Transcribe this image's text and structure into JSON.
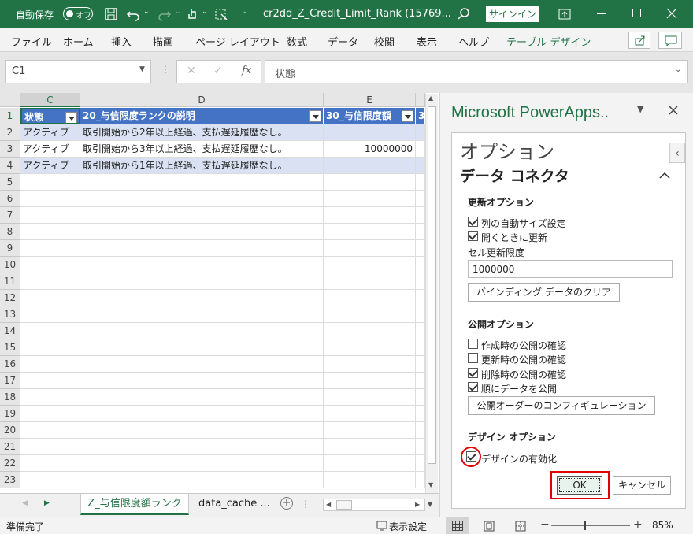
{
  "titlebar": {
    "autosave_label": "自動保存",
    "autosave_state": "オフ",
    "filename": "cr2dd_Z_Credit_Limit_Rank (15769...",
    "signin_label": "サインイン"
  },
  "ribbon": {
    "tabs": [
      "ファイル",
      "ホーム",
      "挿入",
      "描画",
      "ページ レイアウト",
      "数式",
      "データ",
      "校閲",
      "表示",
      "ヘルプ",
      "テーブル デザイン"
    ],
    "active_tab_color": "#217346"
  },
  "formula_bar": {
    "name_box": "C1",
    "fx_label": "fx",
    "content": "状態"
  },
  "sheet": {
    "columns": [
      "C",
      "D",
      "E"
    ],
    "header": [
      "状態",
      "20_与信限度ランクの説明",
      "30_与信限度額",
      "3"
    ],
    "rows": [
      {
        "n": "2",
        "c": "アクティブ",
        "d": "取引開始から2年以上経過、支払遅延履歴なし。",
        "e": ""
      },
      {
        "n": "3",
        "c": "アクティブ",
        "d": "取引開始から3年以上経過、支払遅延履歴なし。",
        "e": "10000000"
      },
      {
        "n": "4",
        "c": "アクティブ",
        "d": "取引開始から1年以上経過、支払遅延履歴なし。",
        "e": ""
      }
    ],
    "header_row_num": "1",
    "empty_rows": [
      "5",
      "6",
      "7",
      "8",
      "9",
      "10",
      "11",
      "12",
      "13",
      "14",
      "15",
      "16",
      "17",
      "18",
      "19",
      "20",
      "21",
      "22",
      "23"
    ],
    "table_header_color": "#4472c4",
    "band_color": "#d9e1f2"
  },
  "sheet_tabs": {
    "active": "Z_与信限度額ランク",
    "other": "data_cache ..."
  },
  "status_bar": {
    "ready": "準備完了",
    "display_settings": "表示設定",
    "zoom": "85%"
  },
  "pane": {
    "title": "Microsoft PowerApps..",
    "options_heading": "オプション",
    "section_title": "データ コネクタ",
    "update_options": "更新オプション",
    "auto_size": "列の自動サイズ設定",
    "refresh_on_open": "開くときに更新",
    "cell_refresh_limit_label": "セル更新限度",
    "cell_refresh_limit_value": "1000000",
    "clear_binding": "バインディング データのクリア",
    "publish_options": "公開オプション",
    "confirm_create": "作成時の公開の確認",
    "confirm_update": "更新時の公開の確認",
    "confirm_delete": "削除時の公開の確認",
    "publish_in_order": "順にデータを公開",
    "configure_publish_order": "公開オーダーのコンフィギュレーション",
    "design_options": "デザイン オプション",
    "enable_design": "デザインの有効化",
    "ok": "OK",
    "cancel": "キャンセル",
    "highlight_color": "#e00000"
  }
}
